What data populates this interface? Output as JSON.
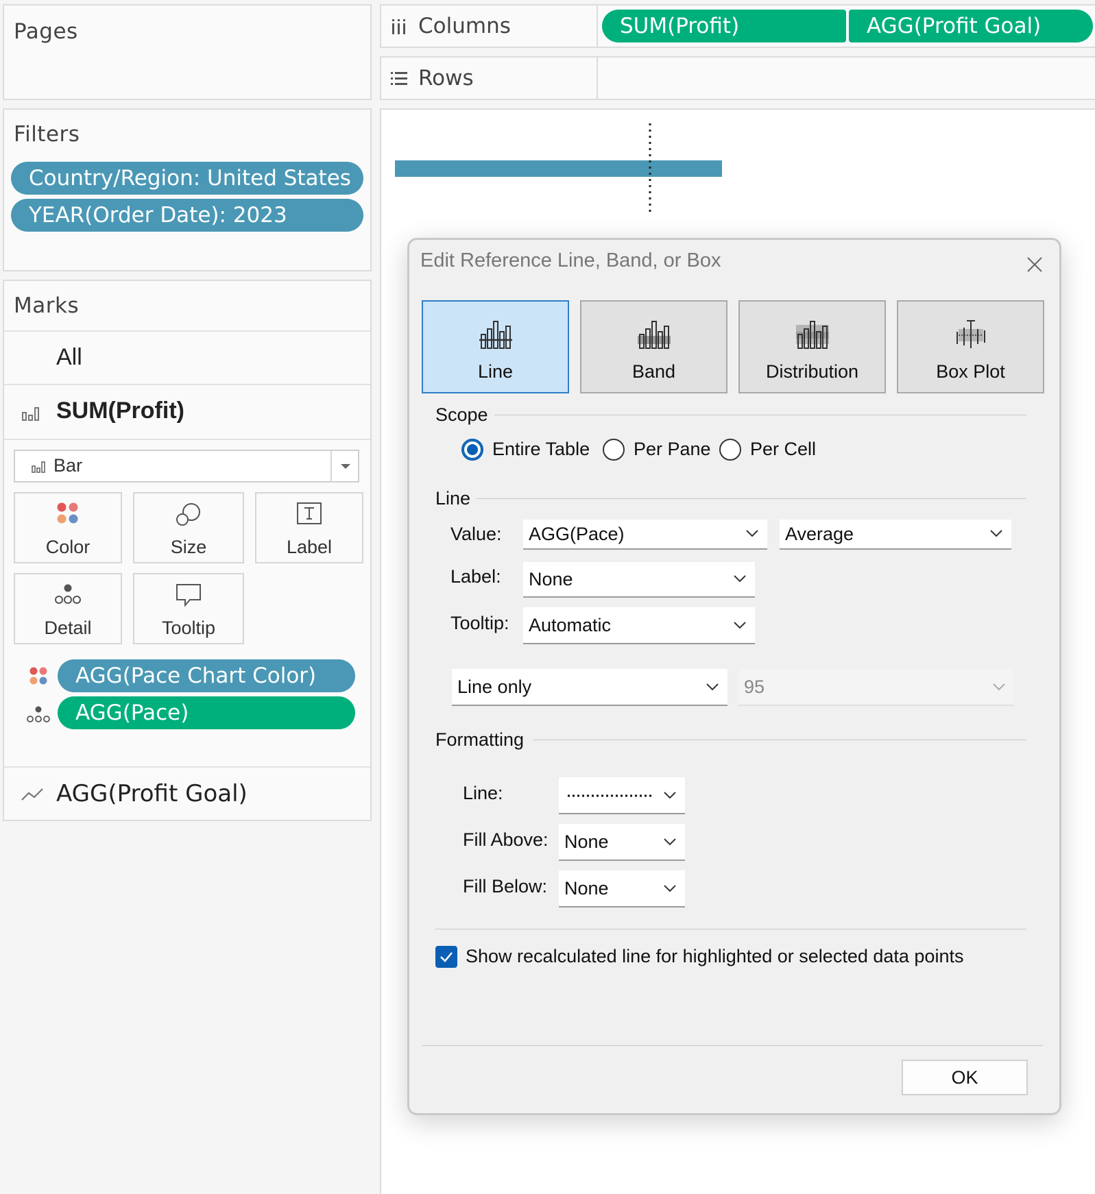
{
  "shelves": {
    "pages_title": "Pages",
    "filters_title": "Filters",
    "filters": [
      "Country/Region: United States",
      "YEAR(Order Date): 2023"
    ],
    "columns_label": "Columns",
    "columns_pills": [
      "SUM(Profit)",
      "AGG(Profit Goal)"
    ],
    "rows_label": "Rows"
  },
  "marks": {
    "title": "Marks",
    "all_label": "All",
    "measure1": "SUM(Profit)",
    "mark_type": "Bar",
    "cards": [
      "Color",
      "Size",
      "Label",
      "Detail",
      "Tooltip"
    ],
    "pills": [
      "AGG(Pace Chart Color)",
      "AGG(Pace)"
    ],
    "measure2": "AGG(Profit Goal)"
  },
  "dialog": {
    "title": "Edit Reference Line, Band, or Box",
    "types": [
      "Line",
      "Band",
      "Distribution",
      "Box Plot"
    ],
    "active_type": "Line",
    "scope_label": "Scope",
    "scope_options": [
      "Entire Table",
      "Per Pane",
      "Per Cell"
    ],
    "scope_selected": "Entire Table",
    "line_section": "Line",
    "value_label": "Value:",
    "value_field": "AGG(Pace)",
    "value_agg": "Average",
    "label_label": "Label:",
    "label_value": "None",
    "tooltip_label": "Tooltip:",
    "tooltip_value": "Automatic",
    "line_mode": "Line only",
    "confidence": "95",
    "formatting_section": "Formatting",
    "line_style_label": "Line:",
    "fill_above_label": "Fill Above:",
    "fill_above_value": "None",
    "fill_below_label": "Fill Below:",
    "fill_below_value": "None",
    "recalc_label": "Show recalculated line for highlighted or selected data points",
    "recalc_checked": true,
    "ok_label": "OK"
  },
  "colors": {
    "blue_pill": "#4a98b5",
    "green_pill": "#00b07c",
    "bar": "#4a98b5",
    "accent": "#0a5fb4"
  },
  "chart_data": {
    "type": "bar",
    "orientation": "horizontal",
    "series": [
      {
        "name": "SUM(Profit)",
        "values": [
          1
        ]
      }
    ],
    "reference_line": {
      "style": "dotted"
    }
  }
}
